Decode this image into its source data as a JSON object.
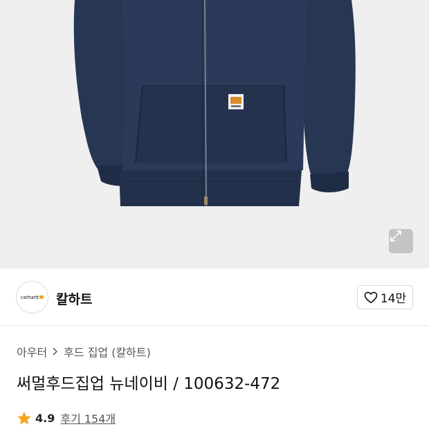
{
  "gallery": {
    "expand_icon": "expand-arrows-icon",
    "background_color": "#efefef",
    "product_color": "#273653"
  },
  "brand": {
    "logo_text": "carhartt",
    "name": "칼하트",
    "like_icon": "heart-outline-icon",
    "like_count": "14만"
  },
  "breadcrumb": {
    "items": [
      "아우터",
      "후드 집업 (칼하트)"
    ],
    "separator_icon": "chevron-right-icon"
  },
  "product": {
    "title": "써멀후드집업 뉴네이비 / 100632-472"
  },
  "rating": {
    "star_icon": "star-icon",
    "star_color": "#f5a623",
    "value": "4.9",
    "reviews_label": "후기 154개"
  }
}
